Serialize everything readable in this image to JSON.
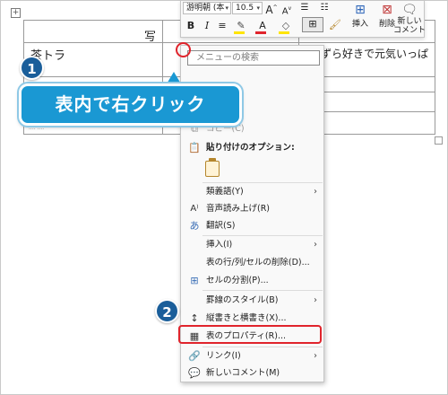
{
  "document": {
    "move_handle_glyph": "+",
    "header_cell_fragment": "写",
    "cell_1": "茶トラ",
    "cell_2": "いずら好きで元気いっぱ",
    "row_fragment": ".... ...."
  },
  "mini_toolbar": {
    "font_name": "游明朝 (本",
    "font_size": "10.5",
    "grow_font": "A",
    "shrink_font": "A",
    "bold": "B",
    "italic": "I",
    "underline": "≡",
    "font_color_glyph": "A",
    "insert_label": "挿入",
    "delete_label": "削除",
    "new_comment_label": "新しい\nコメント"
  },
  "context_menu": {
    "search_placeholder": "メニューの検索",
    "items": [
      {
        "label": "コピー(C)",
        "icon": "copy-icon",
        "disabled": true
      },
      {
        "label": "貼り付けのオプション:",
        "icon": "paste-icon",
        "bold": true
      },
      {
        "label": "類義語(Y)",
        "icon": "",
        "submenu": true
      },
      {
        "label": "音声読み上げ(R)",
        "icon": "read-aloud-icon"
      },
      {
        "label": "翻訳(S)",
        "icon": "translate-icon"
      },
      {
        "label": "挿入(I)",
        "icon": "",
        "submenu": true
      },
      {
        "label": "表の行/列/セルの削除(D)...",
        "icon": ""
      },
      {
        "label": "セルの分割(P)...",
        "icon": "split-cells-icon"
      },
      {
        "label": "罫線のスタイル(B)",
        "icon": "",
        "submenu": true
      },
      {
        "label": "縦書きと横書き(X)...",
        "icon": "text-direction-icon"
      },
      {
        "label": "表のプロパティ(R)...",
        "icon": "table-properties-icon"
      },
      {
        "label": "リンク(I)",
        "icon": "link-icon",
        "submenu": true
      },
      {
        "label": "新しいコメント(M)",
        "icon": "comment-icon"
      }
    ]
  },
  "annotations": {
    "step1_number": "1",
    "step1_callout": "表内で右クリック",
    "step2_number": "2"
  },
  "colors": {
    "accent_red": "#e0242c",
    "callout_blue": "#1a98d3",
    "badge_navy": "#1a5e9a"
  }
}
